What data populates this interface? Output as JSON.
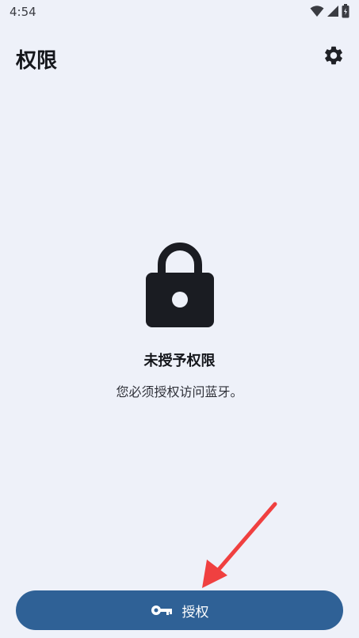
{
  "status_bar": {
    "time": "4:54",
    "icons": [
      "wifi-icon",
      "signal-icon",
      "battery-icon"
    ]
  },
  "app_bar": {
    "title": "权限",
    "settings_icon": "gear-icon"
  },
  "empty_state": {
    "icon": "lock-icon",
    "title": "未授予权限",
    "subtitle": "您必须授权访问蓝牙。"
  },
  "grant_button": {
    "icon": "key-icon",
    "label": "授权"
  },
  "colors": {
    "background": "#EEF1F9",
    "primary": "#2F6196",
    "icon_dark": "#1A1C22",
    "annotation": "#F04040"
  }
}
